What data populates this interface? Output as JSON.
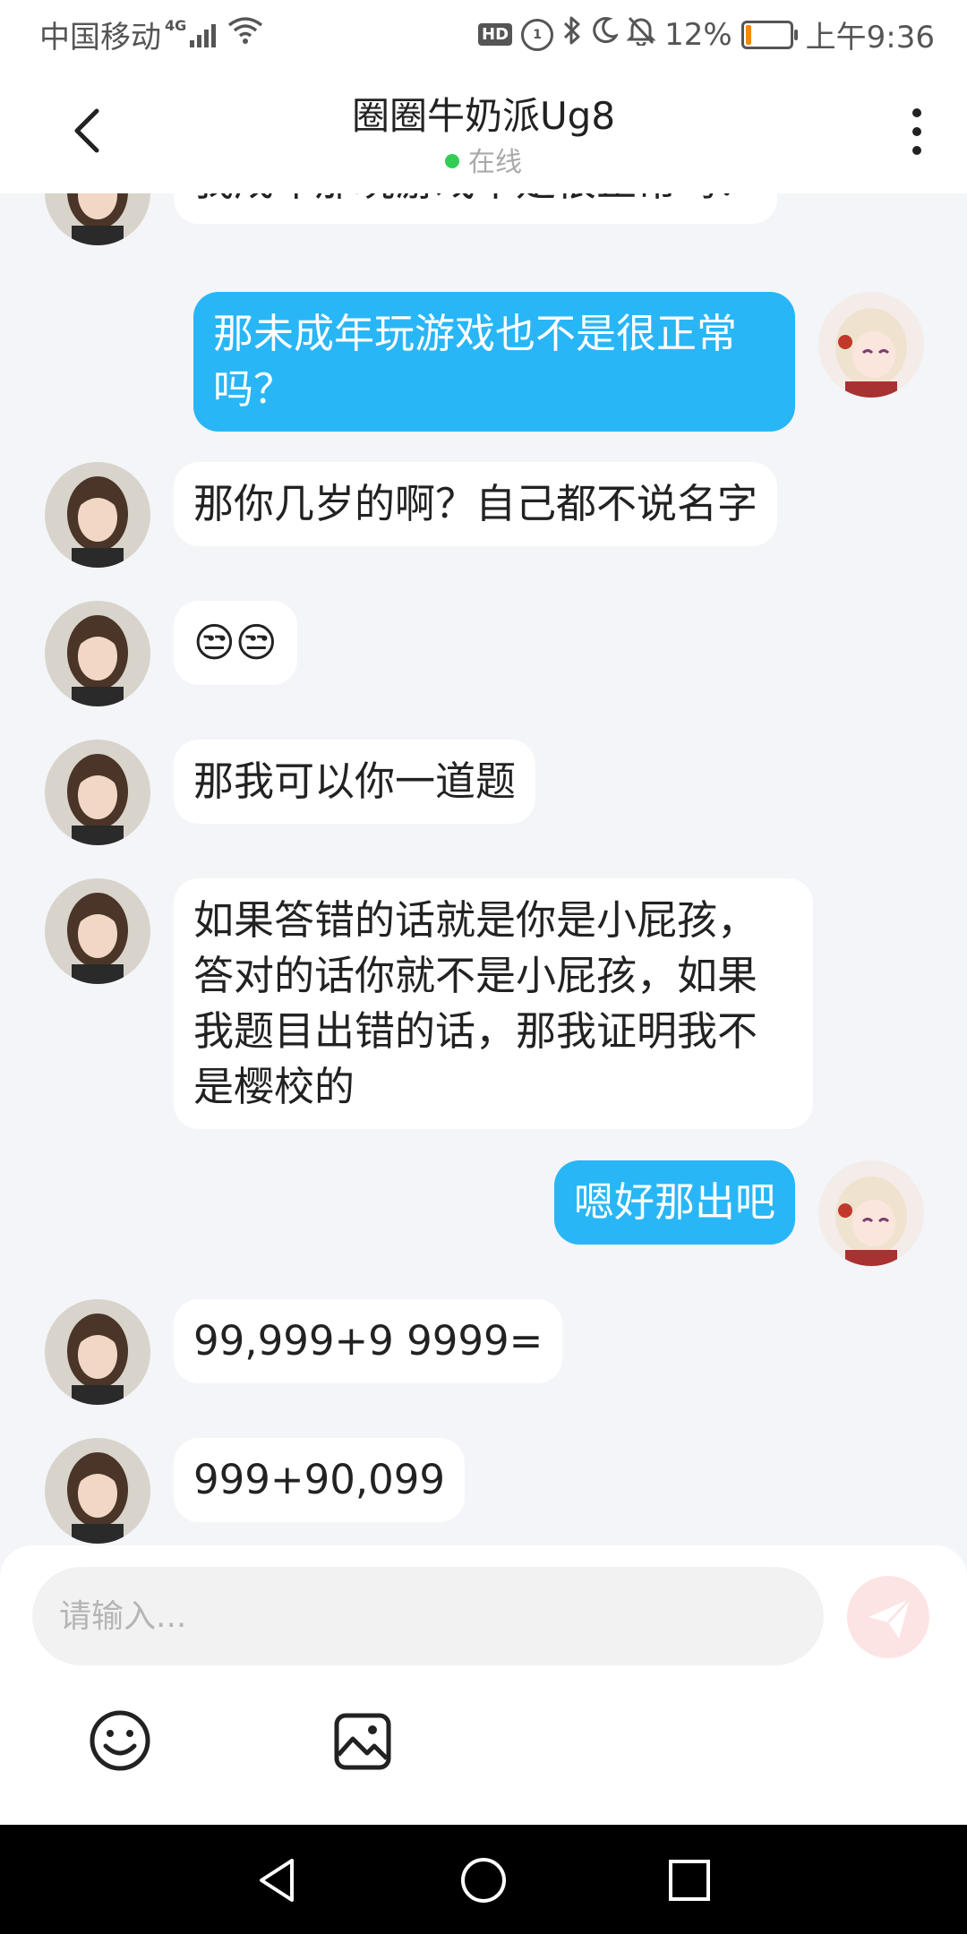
{
  "status_bar": {
    "carrier": "中国移动",
    "network": "4G",
    "hd": "HD",
    "volte": "1",
    "battery": "12%",
    "battery_level": 0.12,
    "time": "上午9:36"
  },
  "header": {
    "title": "圈圈牛奶派Ug8",
    "status": "在线"
  },
  "messages": [
    {
      "side": "in",
      "text": "我成年那玩游戏不是很正常吗？"
    },
    {
      "side": "out",
      "line1": "那未成年玩游戏也不是很正常",
      "line2": "吗？"
    },
    {
      "side": "in",
      "text": "那你几岁的啊？自己都不说名字"
    },
    {
      "side": "in",
      "text": "😒😒"
    },
    {
      "side": "in",
      "text": "那我可以你一道题"
    },
    {
      "side": "in",
      "line1": "如果答错的话就是你是小屁孩，",
      "line2": "答对的话你就不是小屁孩，如果",
      "line3": "我题目出错的话，那我证明我不",
      "line4": "是樱校的"
    },
    {
      "side": "out",
      "text": "嗯好那出吧"
    },
    {
      "side": "in",
      "text": "99,999+9 9999="
    },
    {
      "side": "in",
      "text": "999+90,099"
    }
  ],
  "input": {
    "placeholder": "请输入..."
  },
  "colors": {
    "outgoing_bubble": "#29b6f6",
    "incoming_bubble": "#ffffff",
    "chat_background": "#f3f5f8",
    "online": "#33cc55",
    "send_button": "#fde4e4"
  },
  "icons": {
    "back": "chevron-left-icon",
    "more": "more-vertical-icon",
    "send": "paper-plane-icon",
    "emoji": "smiley-icon",
    "image": "image-icon",
    "nav_back": "triangle-back-icon",
    "nav_home": "circle-home-icon",
    "nav_recents": "square-recents-icon"
  }
}
